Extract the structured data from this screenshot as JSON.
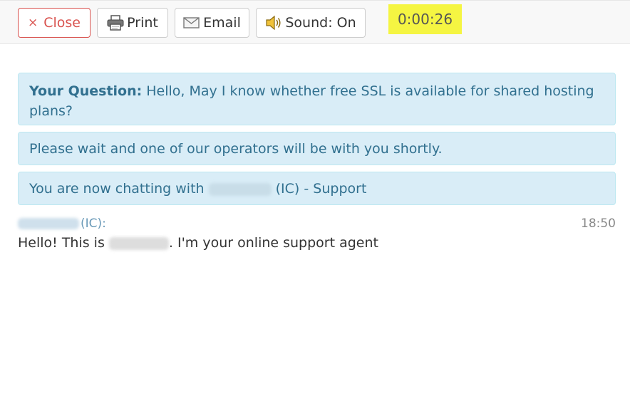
{
  "toolbar": {
    "close_label": "Close",
    "close_glyph": "×",
    "print_label": "Print",
    "email_label": "Email",
    "sound_label": "Sound: On",
    "timer": "0:00:26"
  },
  "messages": {
    "question_label": "Your Question:",
    "question_text": " Hello, May I know whether free SSL is available for shared hosting plans?",
    "wait_text": "Please wait and one of our operators will be with you shortly.",
    "chatting_prefix": "You are now chatting with ",
    "chatting_suffix": " (IC) - Support"
  },
  "chat": {
    "sender_suffix": "(IC):",
    "time": "18:50",
    "text_prefix": "Hello! This is ",
    "text_suffix": ". I'm your online support agent"
  },
  "colors": {
    "close_red": "#d9534f",
    "info_bg": "#d9edf7",
    "info_text": "#31708f",
    "timer_highlight": "#f5f542"
  }
}
